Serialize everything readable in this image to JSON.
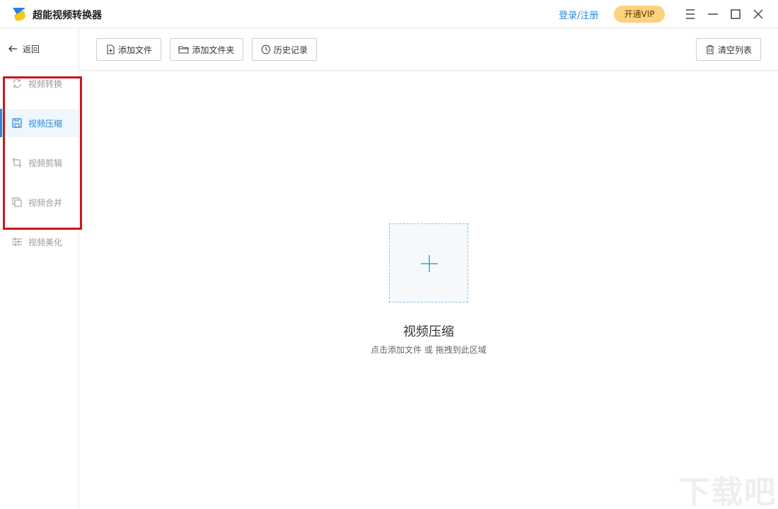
{
  "app": {
    "title": "超能视频转换器",
    "login": "登录/注册",
    "vip": "开通VIP"
  },
  "sidebar": {
    "back_label": "返回",
    "items": [
      {
        "label": "视频转换",
        "icon": "refresh-icon"
      },
      {
        "label": "视频压缩",
        "icon": "save-icon",
        "active": true
      },
      {
        "label": "视频剪辑",
        "icon": "crop-icon"
      },
      {
        "label": "视频合并",
        "icon": "merge-icon"
      },
      {
        "label": "视频美化",
        "icon": "sliders-icon"
      }
    ]
  },
  "toolbar": {
    "add_file": "添加文件",
    "add_folder": "添加文件夹",
    "history": "历史记录",
    "clear_list": "清空列表"
  },
  "dropzone": {
    "title": "视频压缩",
    "hint": "点击添加文件 或 拖拽到此区域"
  },
  "watermark": "下载吧",
  "colors": {
    "accent": "#2b88d8",
    "vip": "#fbd27d",
    "highlight": "#c8181e"
  }
}
